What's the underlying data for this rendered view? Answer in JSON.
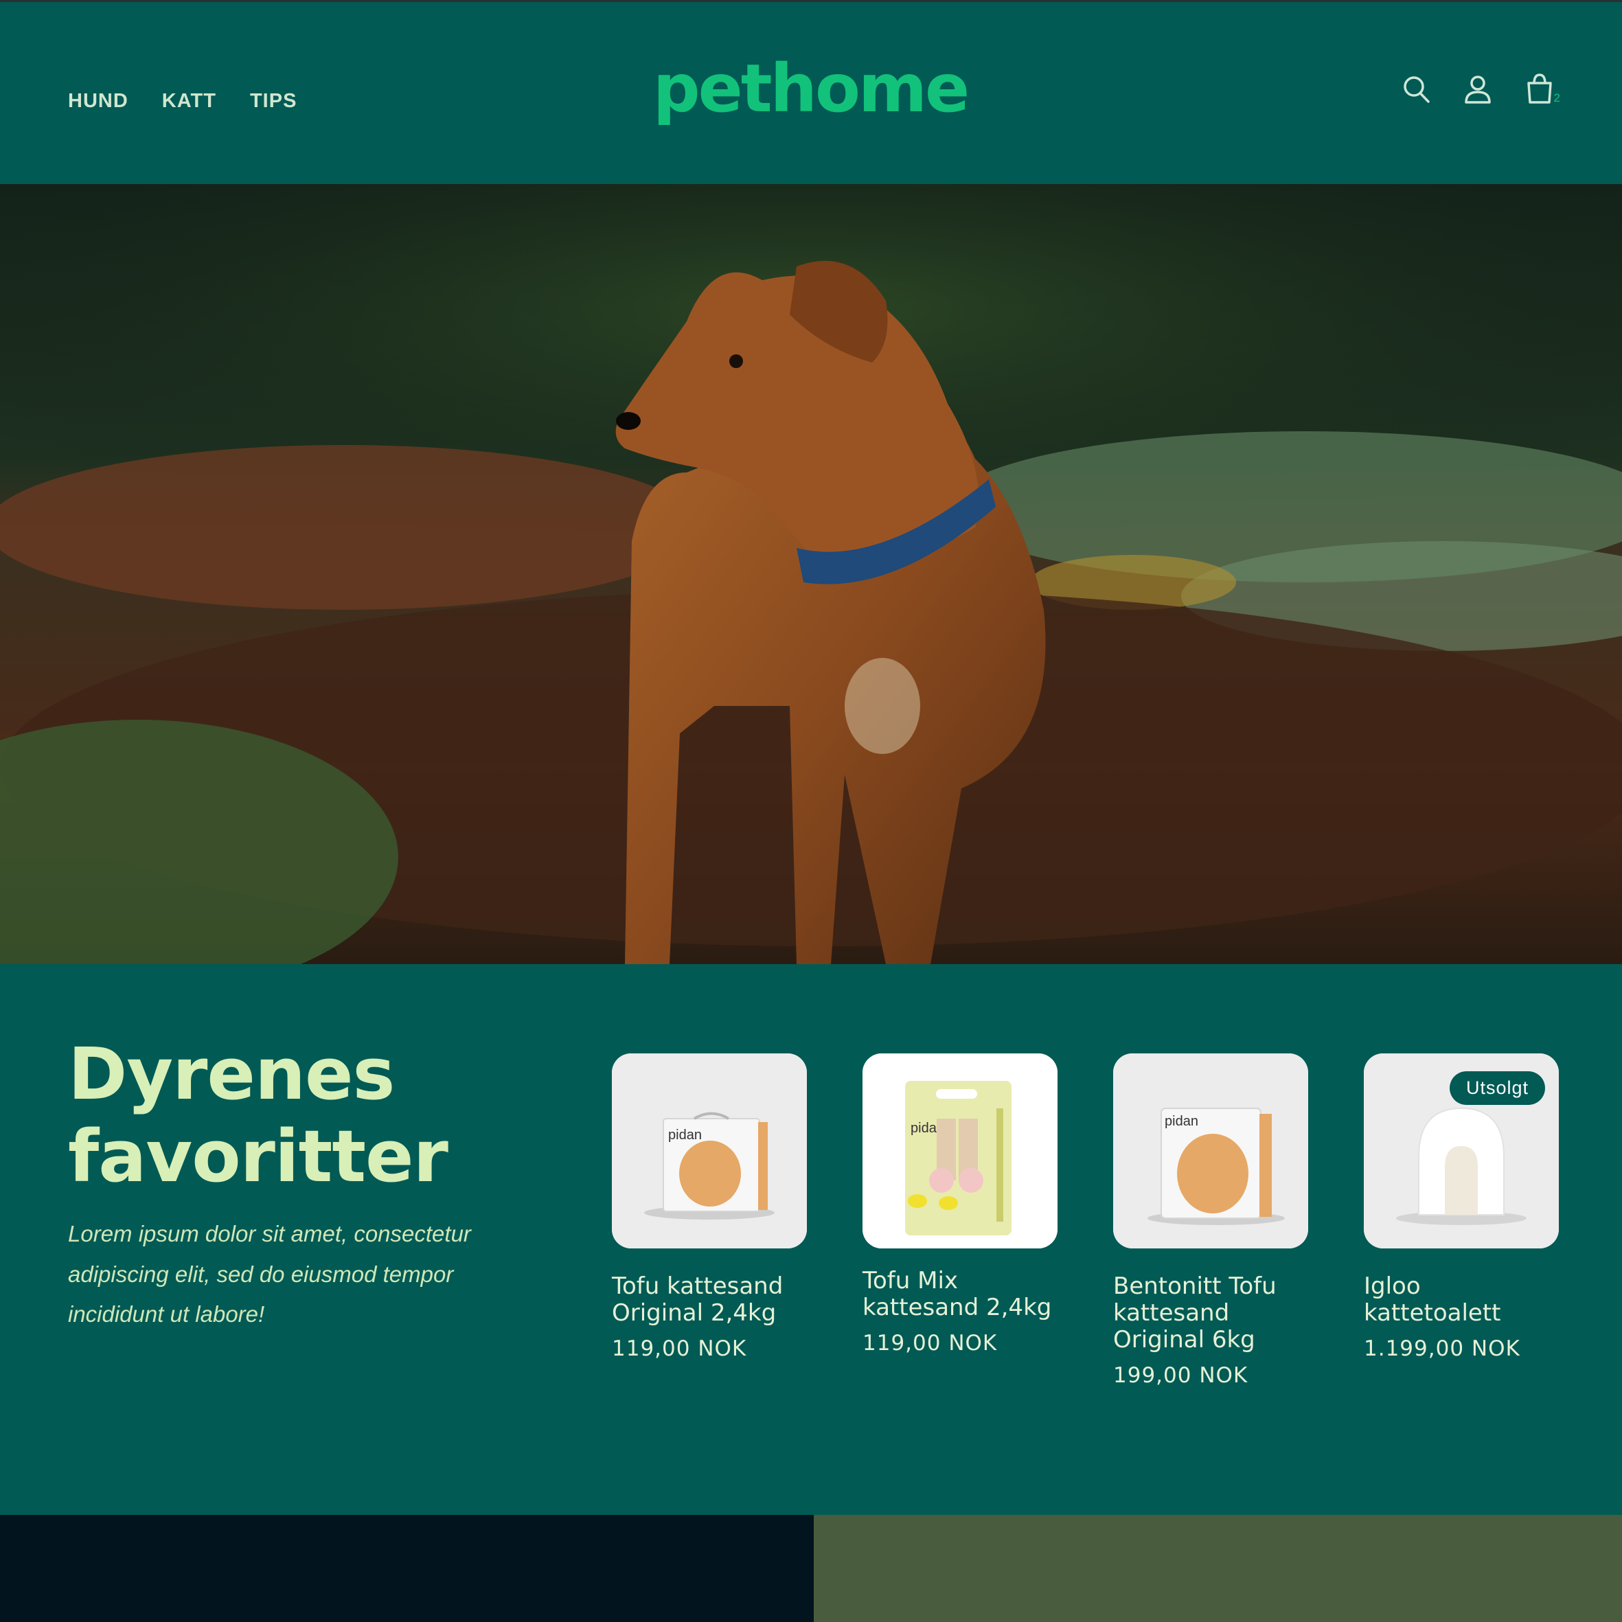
{
  "header": {
    "nav": [
      {
        "label": "HUND"
      },
      {
        "label": "KATT"
      },
      {
        "label": "TIPS"
      }
    ],
    "logo": "pethome",
    "icons": [
      "search-icon",
      "account-icon",
      "cart-icon"
    ],
    "cart_count": "2"
  },
  "hero": {
    "image": "brown dog with blue collar standing in forest clearing"
  },
  "favorites": {
    "title": "Dyrenes favoritter",
    "description": "Lorem ipsum dolor sit amet, consectetur adipiscing elit, sed do eiusmod tempor incididunt ut labore!",
    "products": [
      {
        "name": "Tofu kattesand Original 2,4kg",
        "price": "119,00 NOK",
        "badge": ""
      },
      {
        "name": "Tofu Mix kattesand 2,4kg",
        "price": "119,00 NOK",
        "badge": ""
      },
      {
        "name": "Bentonitt Tofu kattesand Original 6kg",
        "price": "199,00 NOK",
        "badge": ""
      },
      {
        "name": "Igloo kattetoalett",
        "price": "1.199,00 NOK",
        "badge": "Utsolgt"
      }
    ],
    "package_brand": "pidan"
  },
  "colors": {
    "brand_green": "#025a55",
    "logo_green": "#12c27a",
    "headline": "#d8efb7"
  }
}
